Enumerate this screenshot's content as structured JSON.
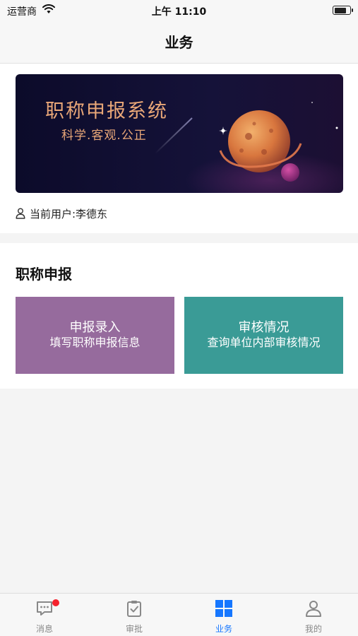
{
  "status_bar": {
    "carrier": "运营商",
    "time": "上午 11:10"
  },
  "nav": {
    "title": "业务"
  },
  "banner": {
    "title": "职称申报系统",
    "subtitle": "科学.客观.公正"
  },
  "user": {
    "label": "当前用户:李德东"
  },
  "section": {
    "title": "职称申报",
    "tiles": [
      {
        "title": "申报录入",
        "subtitle": "填写职称申报信息",
        "color": "#966b9d"
      },
      {
        "title": "审核情况",
        "subtitle": "查询单位内部审核情况",
        "color": "#3a9b96"
      }
    ]
  },
  "tab_bar": {
    "active_color": "#1677ff",
    "items": [
      {
        "label": "消息",
        "icon": "message-icon",
        "has_badge": true
      },
      {
        "label": "审批",
        "icon": "clipboard-check-icon"
      },
      {
        "label": "业务",
        "icon": "grid-icon",
        "active": true
      },
      {
        "label": "我的",
        "icon": "user-icon"
      }
    ]
  }
}
